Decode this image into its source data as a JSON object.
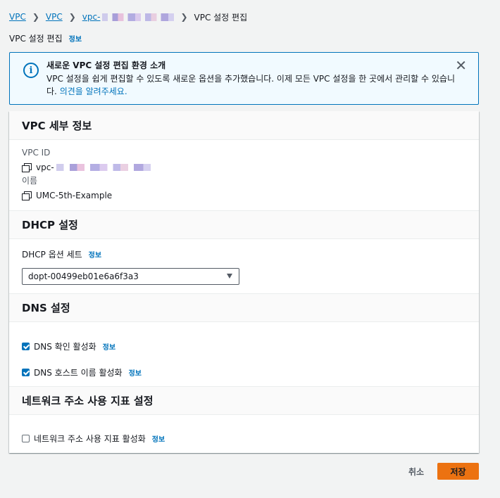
{
  "breadcrumb": {
    "items": [
      "VPC",
      "VPC",
      "vpc-"
    ],
    "current": "VPC 설정 편집"
  },
  "page": {
    "title": "VPC 설정 편집",
    "info_label": "정보"
  },
  "flash": {
    "title": "새로운 VPC 설정 편집 환경 소개",
    "body": "VPC 설정을 쉽게 편집할 수 있도록 새로운 옵션을 추가했습니다. 이제 모든 VPC 설정을 한 곳에서 관리할 수 있습니다.",
    "link": "의견을 알려주세요."
  },
  "vpc_details": {
    "heading": "VPC 세부 정보",
    "vpc_id_label": "VPC ID",
    "vpc_id_value": "vpc-",
    "name_label": "이름",
    "name_value": "UMC-5th-Example"
  },
  "dhcp": {
    "heading": "DHCP 설정",
    "option_label": "DHCP 옵션 세트",
    "info_label": "정보",
    "selected": "dopt-00499eb01e6a6f3a3"
  },
  "dns": {
    "heading": "DNS 설정",
    "resolution_label": "DNS 확인 활성화",
    "hostnames_label": "DNS 호스트 이름 활성화",
    "info_label": "정보",
    "resolution_checked": true,
    "hostnames_checked": true
  },
  "network_metrics": {
    "heading": "네트워크 주소 사용 지표 설정",
    "enable_label": "네트워크 주소 사용 지표 활성화",
    "info_label": "정보",
    "checked": false
  },
  "actions": {
    "cancel": "취소",
    "save": "저장"
  },
  "colors": {
    "link": "#0073bb",
    "primary_button": "#ec7211",
    "flash_background": "#f1faff"
  }
}
